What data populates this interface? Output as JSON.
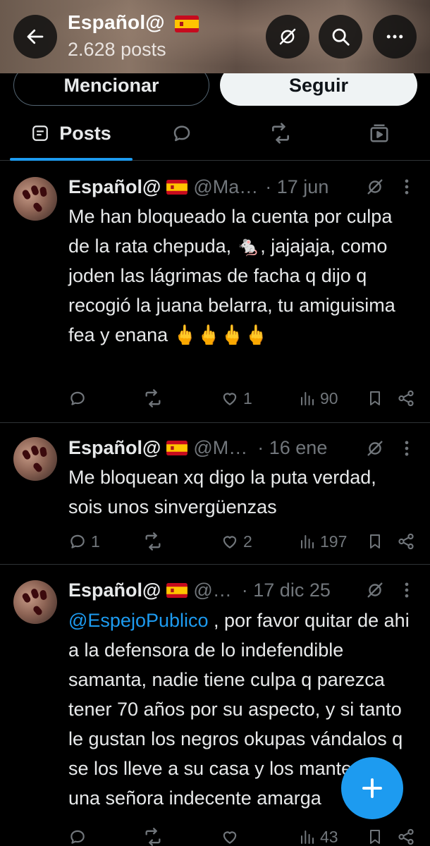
{
  "header": {
    "title": "Español@",
    "flag": "🇪🇸",
    "subtitle": "2.628 posts"
  },
  "buttons": {
    "mention_label": "Mencionar",
    "follow_label": "Seguir"
  },
  "tabs": {
    "posts_label": "Posts",
    "active": "posts"
  },
  "posts": [
    {
      "name": "Español@",
      "handle": "@Ma…",
      "date": "· 17 jun",
      "text": "Me han bloqueado la cuenta por culpa de la rata chepuda, 🐁, jajajaja, como joden las lágrimas de facha q dijo q recogió la juana belarra, tu amiguisima fea y enana 🖕🖕🖕🖕",
      "replies": "",
      "reposts": "",
      "likes": "1",
      "views": "90"
    },
    {
      "name": "Español@",
      "handle": "@M…",
      "date": "· 16 ene",
      "text": "Me bloquean xq digo la puta verdad, sois unos sinvergüenzas",
      "replies": "1",
      "reposts": "",
      "likes": "2",
      "views": "197"
    },
    {
      "name": "Español@",
      "handle": "@…",
      "date": "· 17 dic 25",
      "mention": "@EspejoPublico",
      "text": " , por favor quitar de ahi a la defensora de lo indefendible samanta, nadie tiene culpa q parezca tener 70 años por su aspecto, y si tanto le gustan los negros okupas vándalos q se los lleve a su casa y los mantenga una señora indecente amarga",
      "replies": "",
      "reposts": "",
      "likes": "",
      "views": "43"
    }
  ],
  "colors": {
    "accent": "#1d9bf0",
    "muted": "#71767b",
    "divider": "#2f3336",
    "background": "#000000",
    "text": "#e7e9ea"
  },
  "icons": {
    "back": "arrow-left-icon",
    "sync": "sync-off-icon",
    "search": "search-icon",
    "more": "more-horizontal-icon",
    "compose": "plus-icon"
  }
}
